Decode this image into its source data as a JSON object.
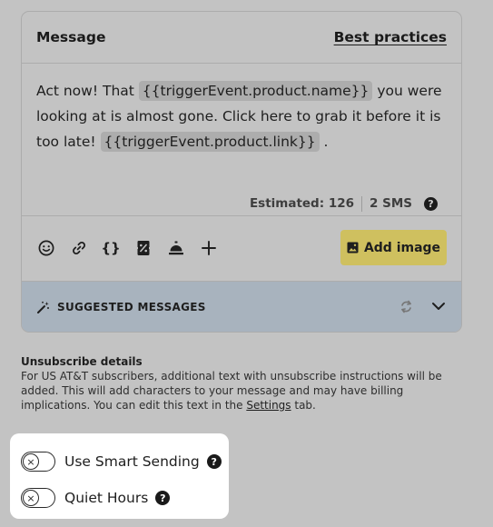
{
  "message_card": {
    "title": "Message",
    "best_practices_link": "Best practices",
    "text_part1": "Act now! That ",
    "token_product_name": "{{triggerEvent.product.name}}",
    "text_part2": " you were looking at is almost gone. Click here to grab it before it is too late! ",
    "token_product_link": "{{triggerEvent.product.link}}",
    "text_part3": " .",
    "estimated_label": "Estimated: 126",
    "sms_count": "2 SMS",
    "help_glyph": "?"
  },
  "toolbar": {
    "tools": [
      "emoji-icon",
      "link-icon",
      "curly-braces-icon",
      "coupon-icon",
      "service-bell-icon",
      "plus-icon"
    ],
    "braces_glyph": "{}",
    "add_image_label": "Add image",
    "add_image_color": "#cfc05f"
  },
  "suggested": {
    "label": "SUGGESTED MESSAGES",
    "background_color": "#a8b3be"
  },
  "unsubscribe": {
    "title": "Unsubscribe details",
    "text_before_link": "For US AT&T subscribers, additional text with unsubscribe instructions will be added. This will add characters to your message and may have billing implications. You can edit this text in the ",
    "link": "Settings",
    "text_after_link": " tab."
  },
  "toggles": [
    {
      "label": "Use Smart Sending",
      "enabled": false,
      "knob_glyph": "×"
    },
    {
      "label": "Quiet Hours",
      "enabled": false,
      "knob_glyph": "×"
    }
  ]
}
